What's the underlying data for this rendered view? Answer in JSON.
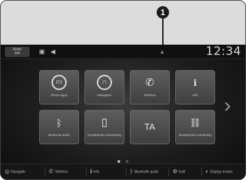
{
  "callout": {
    "number": "1"
  },
  "status_bar": {
    "audio_source_label": "Audio\nAM",
    "time": "12:34"
  },
  "tiles": [
    {
      "label": "Phone apps",
      "icon": "phone-apps-icon"
    },
    {
      "label": "Navigation",
      "icon": "navigation-icon"
    },
    {
      "label": "Telefoon",
      "icon": "phone-icon"
    },
    {
      "label": "Info",
      "icon": "info-icon"
    },
    {
      "label": "Bluetooth audio",
      "icon": "bluetooth-icon"
    },
    {
      "label": "Smartphone-connectivity",
      "icon": "smartphone-icon"
    },
    {
      "label": "TA",
      "icon": "ta-text"
    },
    {
      "label": "Smartphone-connecting",
      "icon": "network-icon"
    }
  ],
  "bottom_bar": [
    {
      "label": "Navigatie",
      "icon": "navigation-icon"
    },
    {
      "label": "Telefoon",
      "icon": "phone-icon"
    },
    {
      "label": "Info",
      "icon": "info-icon"
    },
    {
      "label": "Bluetooth audio",
      "icon": "bluetooth-icon"
    },
    {
      "label": "Instl",
      "icon": "settings-icon"
    },
    {
      "label": "Display modus",
      "icon": "display-icon"
    }
  ],
  "page_indicator": {
    "pages": 2,
    "current": 1
  }
}
